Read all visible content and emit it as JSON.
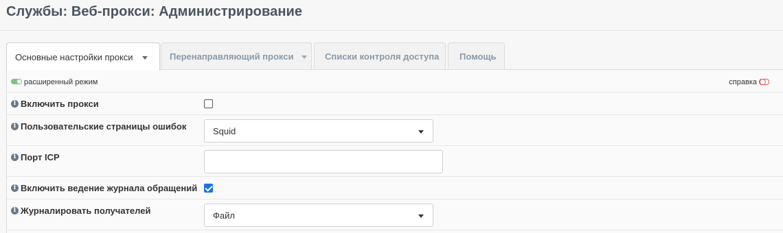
{
  "header": {
    "title": "Службы: Веб-прокси: Администрирование"
  },
  "tabs": [
    {
      "label": "Основные настройки прокси",
      "active": true,
      "has_dropdown": true
    },
    {
      "label": "Перенаправляющий прокси",
      "active": false,
      "has_dropdown": true
    },
    {
      "label": "Списки контроля доступа",
      "active": false,
      "has_dropdown": false
    },
    {
      "label": "Помощь",
      "active": false,
      "has_dropdown": false
    }
  ],
  "mode_bar": {
    "advanced_label": "расширенный режим",
    "advanced_enabled": true,
    "help_label": "справка",
    "help_enabled": false
  },
  "fields": {
    "enable_proxy": {
      "label": "Включить прокси",
      "checked": false
    },
    "error_pages": {
      "label": "Пользовательские страницы ошибок",
      "value": "Squid"
    },
    "icp_port": {
      "label": "Порт ICP",
      "value": ""
    },
    "access_log": {
      "label": "Включить ведение журнала обращений",
      "checked": true
    },
    "log_target": {
      "label": "Журналировать получателей",
      "value": "Файл"
    }
  },
  "icons": {
    "info": "i"
  },
  "colors": {
    "toggle_on": "#7cc47a",
    "toggle_off": "#e05a5a",
    "checkbox_checked": "#1a73e8",
    "title": "#4b5560",
    "inactive_tab_text": "#8a9aa8"
  }
}
